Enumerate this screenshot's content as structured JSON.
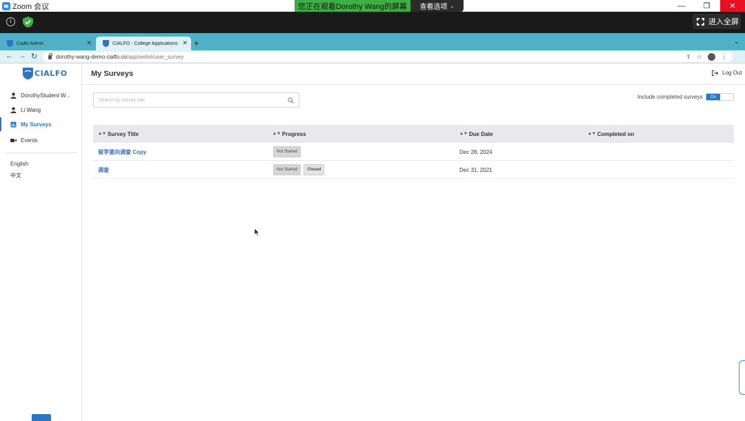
{
  "zoom": {
    "app_title": "Zoom 会议",
    "share_banner": "您正在观看Dorothy Wang的屏幕",
    "view_options": "查看选项",
    "fullscreen": "进入全屏",
    "window_controls": {
      "minimize": "—",
      "restore": "❐",
      "close": "✕"
    }
  },
  "browser": {
    "tabs": [
      {
        "title": "Cialfo Admin",
        "active": false
      },
      {
        "title": "CIALFO - College Applications",
        "active": true
      }
    ],
    "new_tab": "+",
    "url_domain": "dorothy-wang-demo.cialfo.co",
    "url_path": "/app/web#/user_survey"
  },
  "sidebar": {
    "brand": "CIALFO",
    "items": [
      {
        "label": "DorothyStudent W...",
        "icon": "user-icon"
      },
      {
        "label": "Li Wang",
        "icon": "user-icon"
      },
      {
        "label": "My Surveys",
        "icon": "survey-icon",
        "active": true
      },
      {
        "label": "Events",
        "icon": "video-icon"
      }
    ],
    "languages": [
      "English",
      "中文"
    ]
  },
  "header": {
    "title": "My Surveys",
    "logout": "Log Out"
  },
  "filters": {
    "search_placeholder": "Search by survey title",
    "toggle_label": "Include completed surveys",
    "toggle_state": "On"
  },
  "table": {
    "columns": [
      "Survey Title",
      "Progress",
      "Due Date",
      "Completed on"
    ],
    "rows": [
      {
        "title": "留学意向调查 Copy",
        "progress": [
          "Not Started"
        ],
        "due": "Dec 28, 2024",
        "completed": ""
      },
      {
        "title": "调查",
        "progress": [
          "Not Started",
          "Closed"
        ],
        "due": "Dec 31, 2021",
        "completed": ""
      }
    ]
  },
  "colors": {
    "accent": "#2d74c4",
    "zoom_green": "#3cb043",
    "tab_strip": "#4fb0c6",
    "close_red": "#e81123"
  }
}
